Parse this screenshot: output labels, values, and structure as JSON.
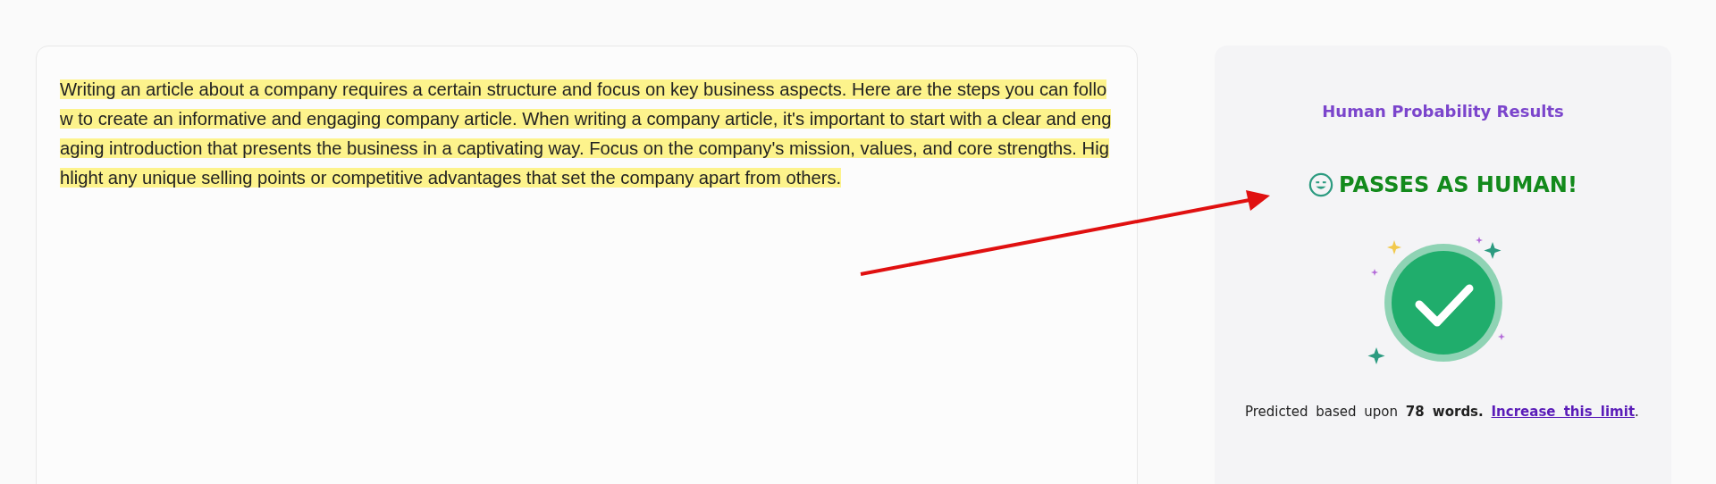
{
  "editor": {
    "lines": [
      "Writing an article about a company requires a certain structure and focus on key business aspects. Here are the steps you can follo",
      "w to create an informative and engaging company article. When writing a company article, it's important to start with a clear and eng",
      "aging introduction that presents the business in a captivating way. Focus on the company's mission, values, and core strengths. Hig",
      "hlight any unique selling points or competitive advantages that set the company apart from others. "
    ],
    "highlighted": true
  },
  "results": {
    "title": "Human Probability Results",
    "verdict": {
      "text": "PASSES AS HUMAN!",
      "kind": "human"
    },
    "summary": "Predicted based upon **78 words.**",
    "link": "Increase this limit",
    "after_link": "."
  }
}
